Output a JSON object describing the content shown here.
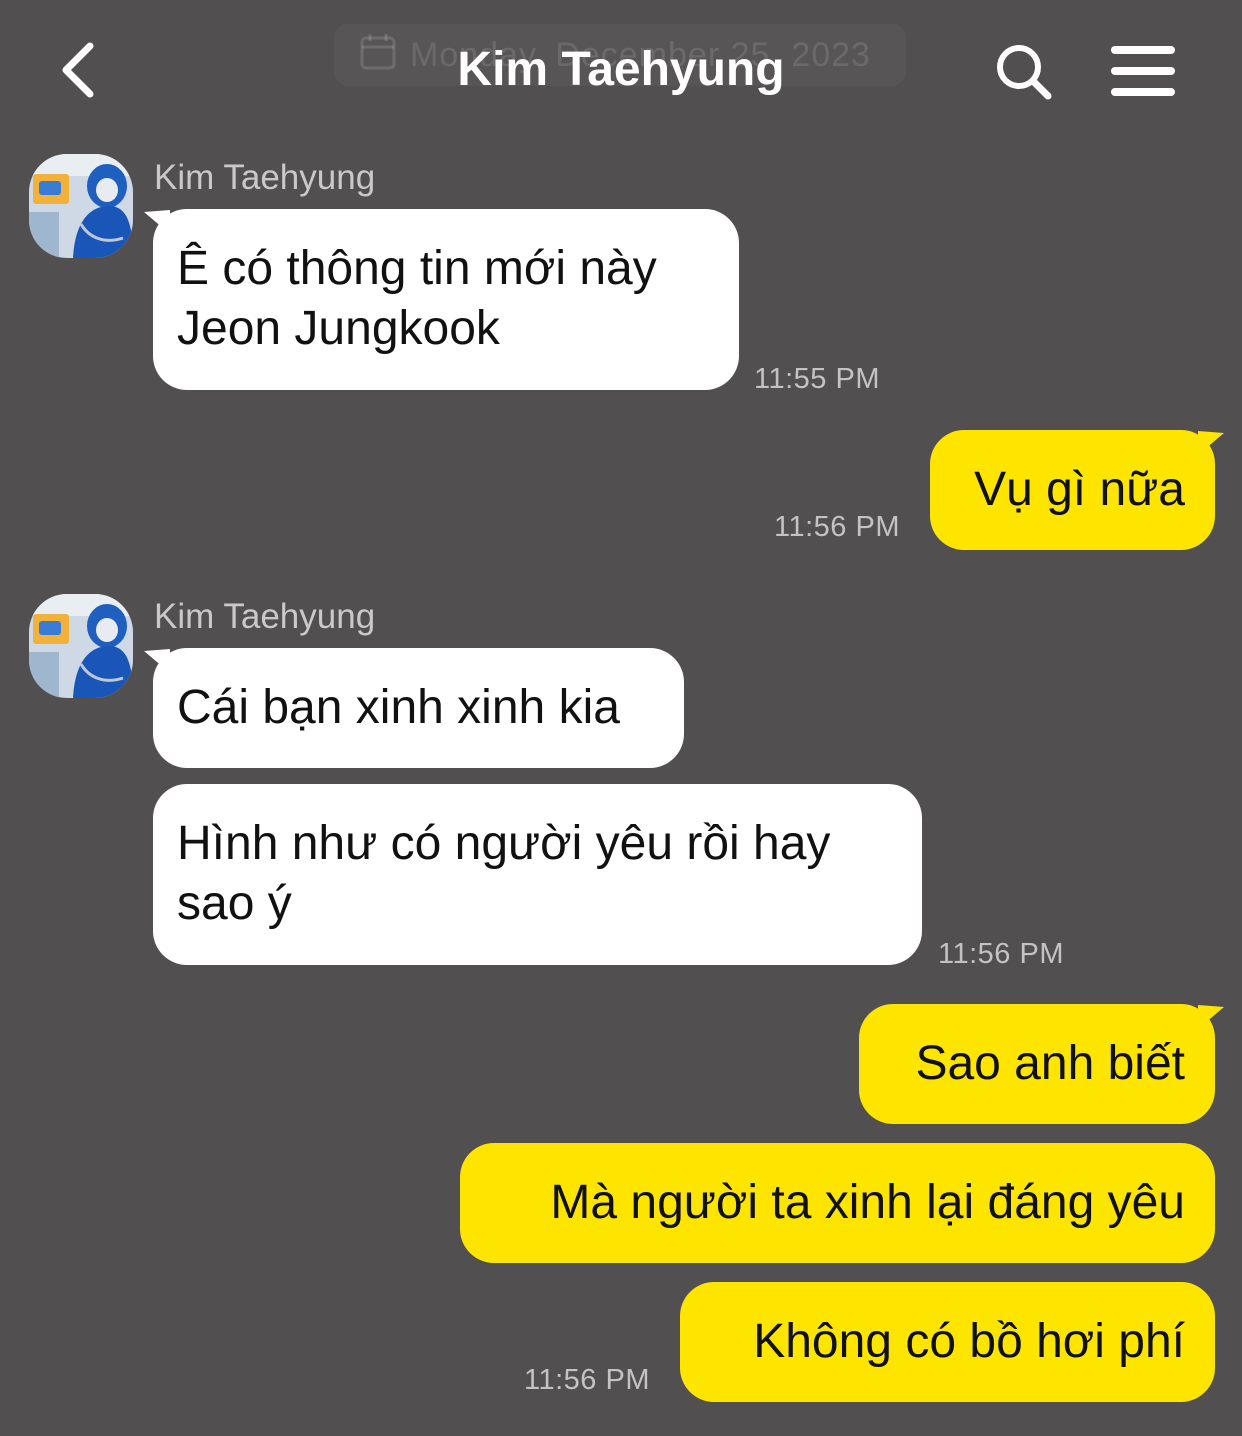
{
  "header": {
    "title": "Kim Taehyung",
    "date_overlay": "Monday, December 25, 2023"
  },
  "colors": {
    "background": "#514f50",
    "incoming_bubble": "#ffffff",
    "outgoing_bubble": "#fee500"
  },
  "icons": {
    "back": "chevron-left-icon",
    "search": "search-icon",
    "menu": "hamburger-menu-icon",
    "date": "calendar-icon"
  },
  "messages": [
    {
      "sender": "Kim Taehyung",
      "text_lines": [
        "Ê có thông tin mới này",
        "Jeon Jungkook"
      ],
      "time": "11:55 PM"
    },
    {
      "text": "Vụ gì nữa",
      "time": "11:56 PM"
    },
    {
      "sender": "Kim Taehyung",
      "text": "Cái bạn xinh xinh kia"
    },
    {
      "text_lines": [
        "Hình như có người yêu rồi hay",
        "sao ý"
      ],
      "time": "11:56 PM"
    },
    {
      "text": "Sao anh biết"
    },
    {
      "text": "Mà người ta xinh lại đáng yêu"
    },
    {
      "text": "Không có bồ hơi phí",
      "time": "11:56 PM"
    }
  ]
}
